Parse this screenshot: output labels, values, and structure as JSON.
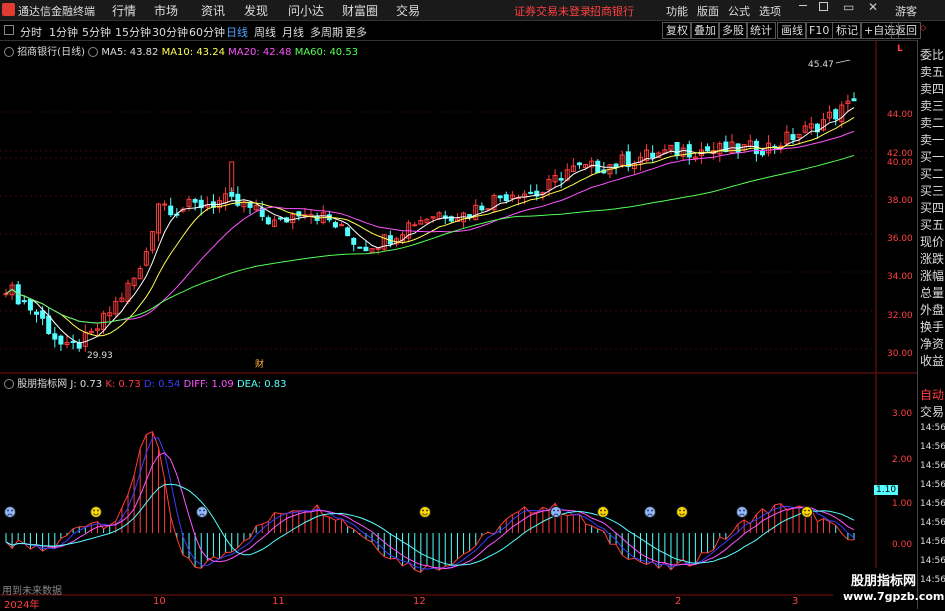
{
  "app": {
    "title": "通达信金融终端"
  },
  "menu": [
    "行情",
    "市场",
    "资讯",
    "发现",
    "问小达",
    "财富圈",
    "交易"
  ],
  "notice": {
    "text": "证券交易未登录",
    "stock": "招商银行"
  },
  "right_menu": [
    "功能",
    "版面",
    "公式",
    "选项"
  ],
  "user": "游客",
  "periods": [
    "分时",
    "1分钟",
    "5分钟",
    "15分钟",
    "30分钟",
    "60分钟",
    "日线",
    "周线",
    "月线",
    "多周期",
    "更多"
  ],
  "active_period": "日线",
  "toolbar": [
    "复权",
    "叠加",
    "多股",
    "统计",
    "画线",
    "F10",
    "标记",
    "+自选",
    "返回"
  ],
  "stock_info": {
    "name": "招商银行(日线)",
    "ma5": "MA5: 43.82",
    "ma10": "MA10: 43.24",
    "ma20": "MA20: 42.48",
    "ma60": "MA60: 40.53"
  },
  "indicator_info": {
    "name": "股朋指标网",
    "j": "J: 0.73",
    "k": "K: 0.73",
    "d": "D: 0.54",
    "diff": "DIFF: 1.09",
    "dea": "DEA: 0.83"
  },
  "price_axis": [
    "44.00",
    "42.00",
    "40.00",
    "38.00",
    "36.00",
    "34.00",
    "32.00",
    "30.00"
  ],
  "price_axis_top": "L",
  "indicator_axis": [
    "3.00",
    "2.00",
    "1.00",
    "0.00"
  ],
  "indicator_current": "1.10",
  "x_axis": [
    "2024年",
    "10",
    "11",
    "12",
    "2",
    "3"
  ],
  "annotations": {
    "high": "45.47",
    "low": "29.93",
    "fin_mark": "财",
    "bottom_text": "用到未来数据"
  },
  "right_panel": {
    "labels": [
      "委比",
      "卖五",
      "卖四",
      "卖三",
      "卖二",
      "卖一",
      "买一",
      "买二",
      "买三",
      "买四",
      "买五",
      "现价",
      "涨跌",
      "涨幅",
      "总量",
      "外盘",
      "换手",
      "净资",
      "收益"
    ],
    "auto": "自动",
    "trade": "交易",
    "times": [
      "14:56",
      "14:56",
      "14:56",
      "14:56",
      "14:56",
      "14:56",
      "14:56",
      "14:56",
      "14:56"
    ]
  },
  "watermark": {
    "line1": "股朋指标网",
    "line2": "www.7gpzb.com"
  },
  "colors": {
    "up": "#ff3c3c",
    "down": "#54ffff",
    "ma5": "#ffffff",
    "ma10": "#ffff54",
    "ma20": "#ff54ff",
    "ma60": "#54ff54"
  }
}
